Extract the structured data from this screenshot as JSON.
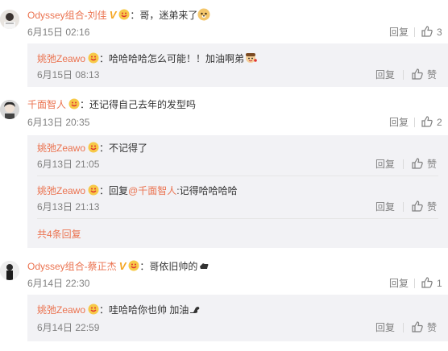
{
  "comments": [
    {
      "user": "Odyssey组合-刘佳",
      "text": "：哥，迷弟来了",
      "time": "6月15日 02:16",
      "reply_label": "回复",
      "likes": "3"
    },
    {
      "user": "千面智人",
      "text": "：还记得自己去年的发型吗",
      "time": "6月13日 20:35",
      "reply_label": "回复",
      "likes": "2"
    },
    {
      "user": "Odyssey组合-蔡正杰",
      "text": "：哥依旧帅的",
      "time": "6月14日 22:30",
      "reply_label": "回复",
      "likes": "1"
    }
  ],
  "replies": [
    {
      "user": "姚弛Zeawo",
      "text": "：哈哈哈哈怎么可能！！加油啊弟",
      "time": "6月15日 08:13",
      "reply_label": "回复",
      "like_label": "赞"
    },
    {
      "user": "姚弛Zeawo",
      "text": "：不记得了",
      "time": "6月13日 21:05",
      "reply_label": "回复",
      "like_label": "赞"
    },
    {
      "user": "姚弛Zeawo",
      "text_prefix": "：回复",
      "mention": "@千面智人",
      "text": ":记得哈哈哈哈",
      "time": "6月13日 21:13",
      "reply_label": "回复",
      "like_label": "赞"
    },
    {
      "user": "姚弛Zeawo",
      "text": "：哇哈哈你也帅 加油",
      "time": "6月14日 22:59",
      "reply_label": "回复",
      "like_label": "赞"
    }
  ],
  "more_replies": "共4条回复",
  "colors": {
    "link": "#eb7350",
    "meta": "#808080",
    "reply_bg": "#f2f2f5"
  }
}
